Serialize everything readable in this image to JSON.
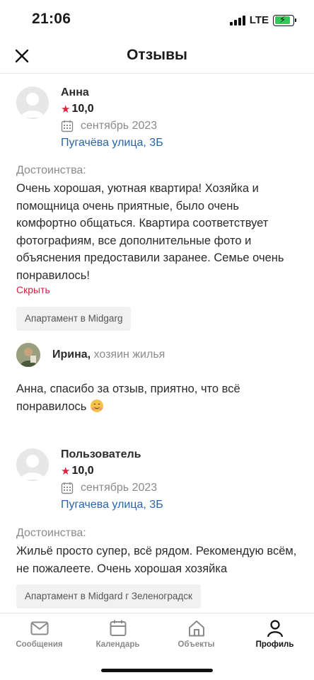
{
  "status_bar": {
    "time": "21:06",
    "network": "LTE"
  },
  "header": {
    "title": "Отзывы",
    "close_icon": "close-icon"
  },
  "reviews": [
    {
      "author": "Анна",
      "rating": "10,0",
      "date": "сентябрь 2023",
      "address": "Пугачёва улица, 3Б",
      "label": "Достоинства:",
      "text": "Очень хорошая, уютная квартира! Хозяйка и помощница очень приятные, было очень комфортно общаться. Квартира соответствует фотографиям, все дополнительные фото и объяснения предоставили заранее. Семье очень понравилось!",
      "hide_label": "Скрыть",
      "tag": "Апартамент в Midgarg",
      "reply": {
        "host_name": "Ирина,",
        "host_role": "хозяин жилья",
        "text": "Анна, спасибо за отзыв, приятно, что всё понравилось"
      }
    },
    {
      "author": "Пользователь",
      "rating": "10,0",
      "date": "сентябрь 2023",
      "address": "Пугачева улица, 3Б",
      "label": "Достоинства:",
      "text": "Жильё просто супер, всё рядом. Рекомендую всём, не пожалеете. Очень хорошая хозяйка",
      "tag": "Апартамент в Midgard г Зеленоградск"
    }
  ],
  "tabs": [
    {
      "label": "Сообщения",
      "icon": "mail-icon",
      "active": false
    },
    {
      "label": "Календарь",
      "icon": "calendar-icon",
      "active": false
    },
    {
      "label": "Объекты",
      "icon": "home-icon",
      "active": false
    },
    {
      "label": "Профиль",
      "icon": "profile-icon",
      "active": true
    }
  ],
  "colors": {
    "accent": "#d62140",
    "link": "#2a64a8",
    "muted": "#8a8a8a"
  }
}
